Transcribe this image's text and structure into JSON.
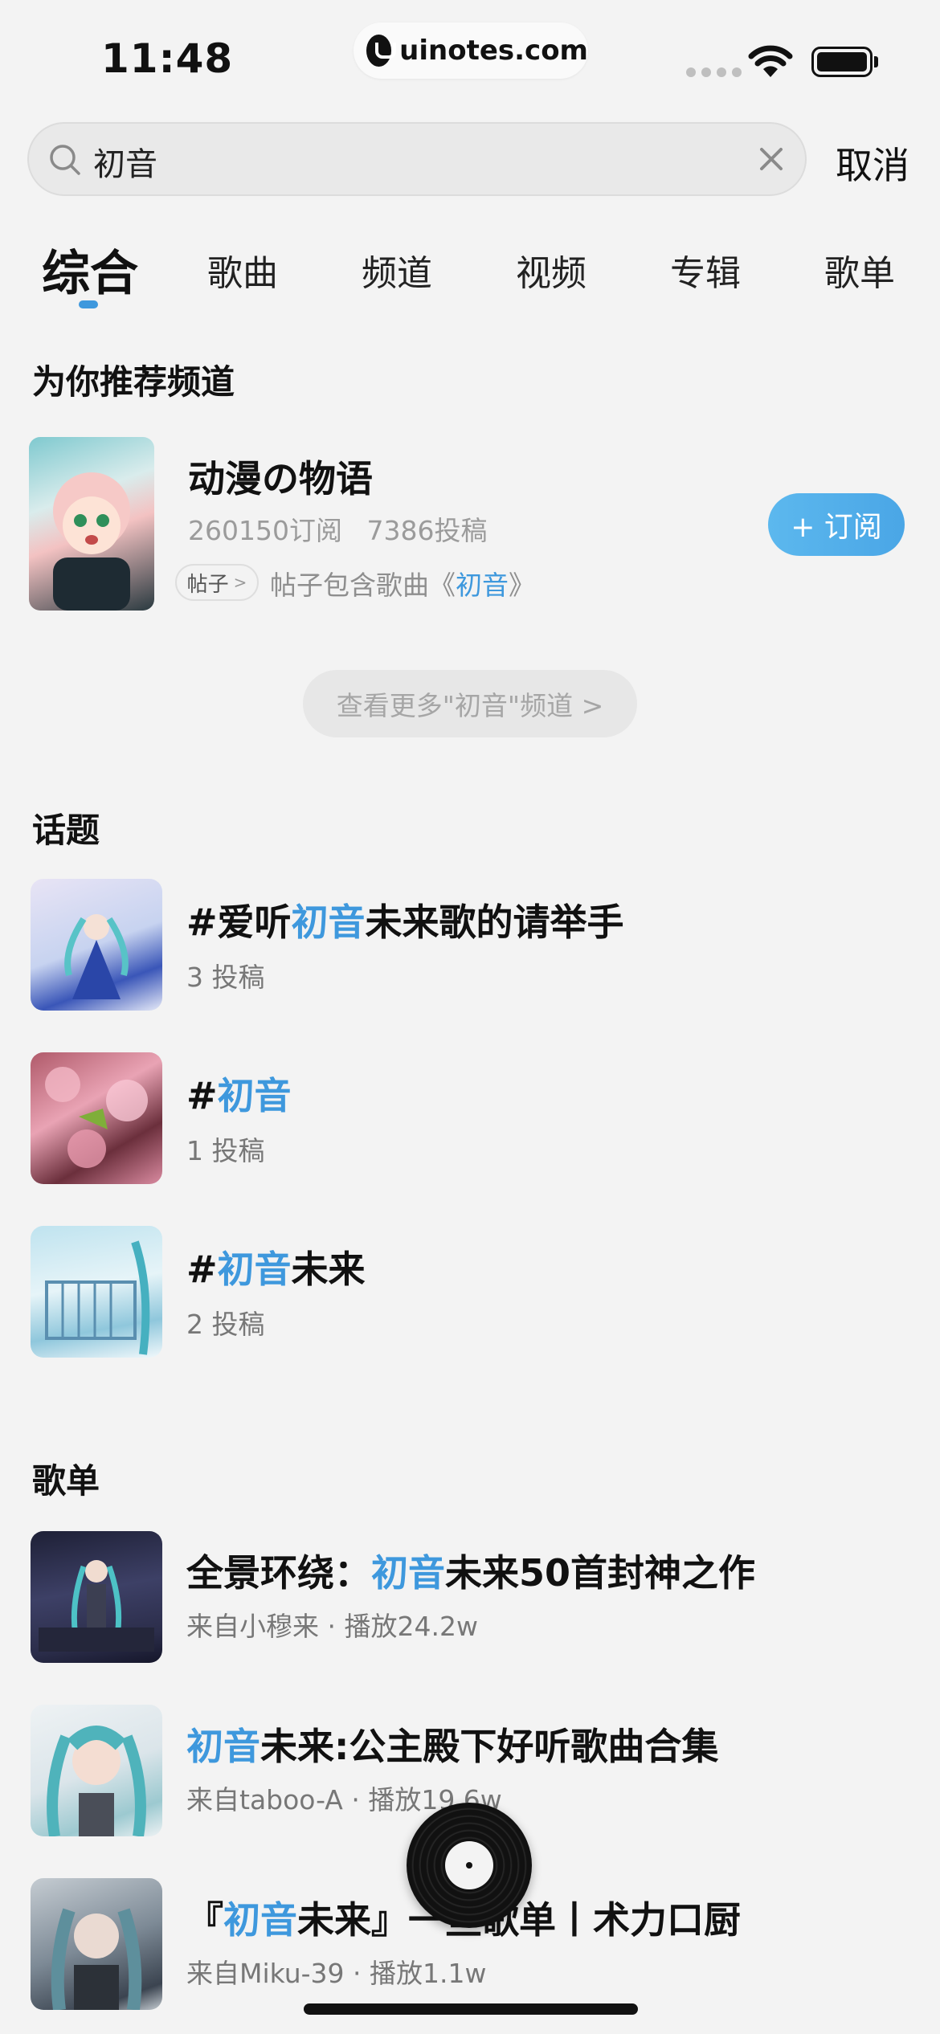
{
  "status_bar": {
    "time": "11:48",
    "watermark": "uinotes.com"
  },
  "search": {
    "value": "初音",
    "cancel": "取消"
  },
  "tabs": [
    "综合",
    "歌曲",
    "频道",
    "视频",
    "专辑",
    "歌单"
  ],
  "recommend": {
    "title": "为你推荐频道",
    "channel": {
      "name": "动漫の物语",
      "subscribers": "260150订阅",
      "posts": "7386投稿",
      "subscribe_label": "+ 订阅",
      "tag": "帖子",
      "tag_chevron": ">",
      "desc_prefix": "帖子包含歌曲《",
      "desc_highlight": "初音",
      "desc_suffix": "》"
    },
    "more": "查看更多\"初音\"频道 >"
  },
  "topics": {
    "title": "话题",
    "items": [
      {
        "prefix": "#爱听",
        "highlight": "初音",
        "suffix": "未来歌的请举手",
        "count": "3 投稿"
      },
      {
        "prefix": "#",
        "highlight": "初音",
        "suffix": "",
        "count": "1 投稿"
      },
      {
        "prefix": "#",
        "highlight": "初音",
        "suffix": "未来",
        "count": "2 投稿"
      }
    ]
  },
  "playlists": {
    "title": "歌单",
    "items": [
      {
        "prefix": "全景环绕：",
        "highlight": "初音",
        "suffix": "未来50首封神之作",
        "sub": "来自小穆来 · 播放24.2w"
      },
      {
        "prefix": "",
        "highlight": "初音",
        "suffix": "未来:公主殿下好听歌曲合集",
        "sub": "来自taboo-A · 播放19.6w"
      },
      {
        "prefix": "『",
        "highlight": "初音",
        "suffix": "未来』一些歌单丨术力口厨",
        "sub": "来自Miku-39 · 播放1.1w"
      }
    ]
  },
  "colors": {
    "accent": "#3e98dd",
    "background": "#f3f3f3"
  }
}
